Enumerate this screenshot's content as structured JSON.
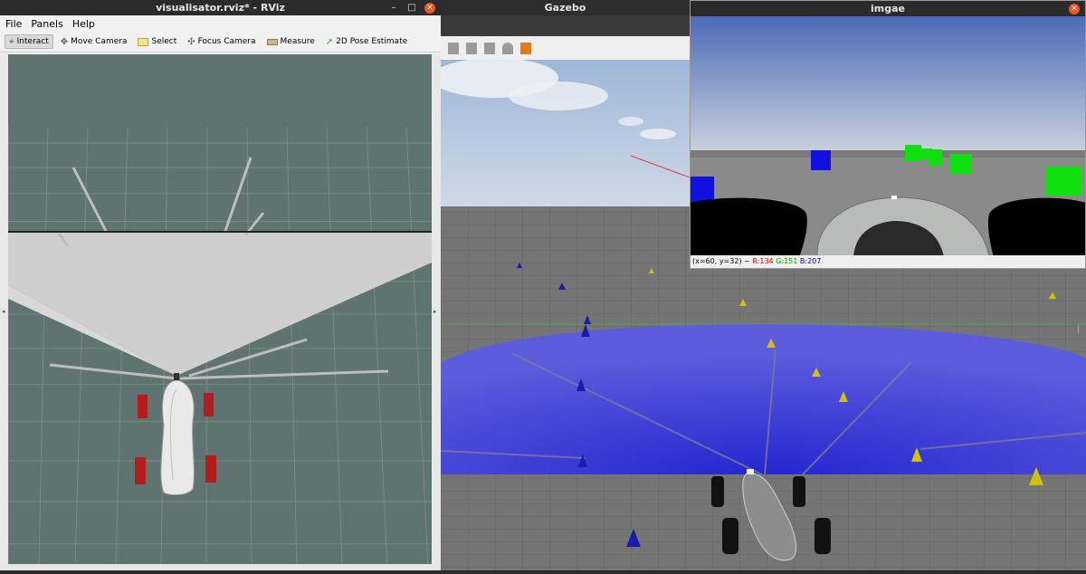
{
  "rviz": {
    "title": "visualisator.rviz* - RViz",
    "menu": [
      "File",
      "Panels",
      "Help"
    ],
    "tools": [
      {
        "label": "Interact",
        "icon": "interact-icon"
      },
      {
        "label": "Move Camera",
        "icon": "move-camera-icon"
      },
      {
        "label": "Select",
        "icon": "select-icon"
      },
      {
        "label": "Focus Camera",
        "icon": "focus-camera-icon"
      },
      {
        "label": "Measure",
        "icon": "measure-icon"
      },
      {
        "label": "2D Pose Estimate",
        "icon": "pose-estimate-icon"
      }
    ]
  },
  "gazebo": {
    "title": "Gazebo"
  },
  "image_window": {
    "title": "imgae",
    "coords": "(x=60, y=32) ~",
    "r": "R:134",
    "g": "G:151",
    "b": "B:207"
  },
  "colors": {
    "rviz_bg": "#5f7370",
    "laser_plane": "#2828f0",
    "title_bar": "#2b2b2b",
    "close_button": "#e95420"
  }
}
